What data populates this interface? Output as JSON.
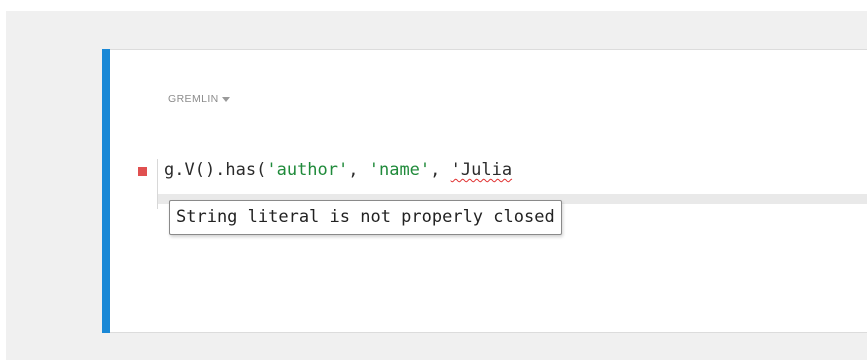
{
  "editor": {
    "language_label": "GREMLIN",
    "language_dropdown_icon": "caret-down-icon",
    "error_marker_icon": "error-square-icon",
    "error_marker_color": "#e05050",
    "accent_color": "#1a88d6",
    "string_color": "#1f8a3a",
    "code_tokens": {
      "t1": "g.V().has(",
      "t2": "'author'",
      "t3": ", ",
      "t4": "'name'",
      "t5": ", ",
      "t6": "'Julia"
    },
    "tooltip_text": "String literal is not properly closed"
  }
}
